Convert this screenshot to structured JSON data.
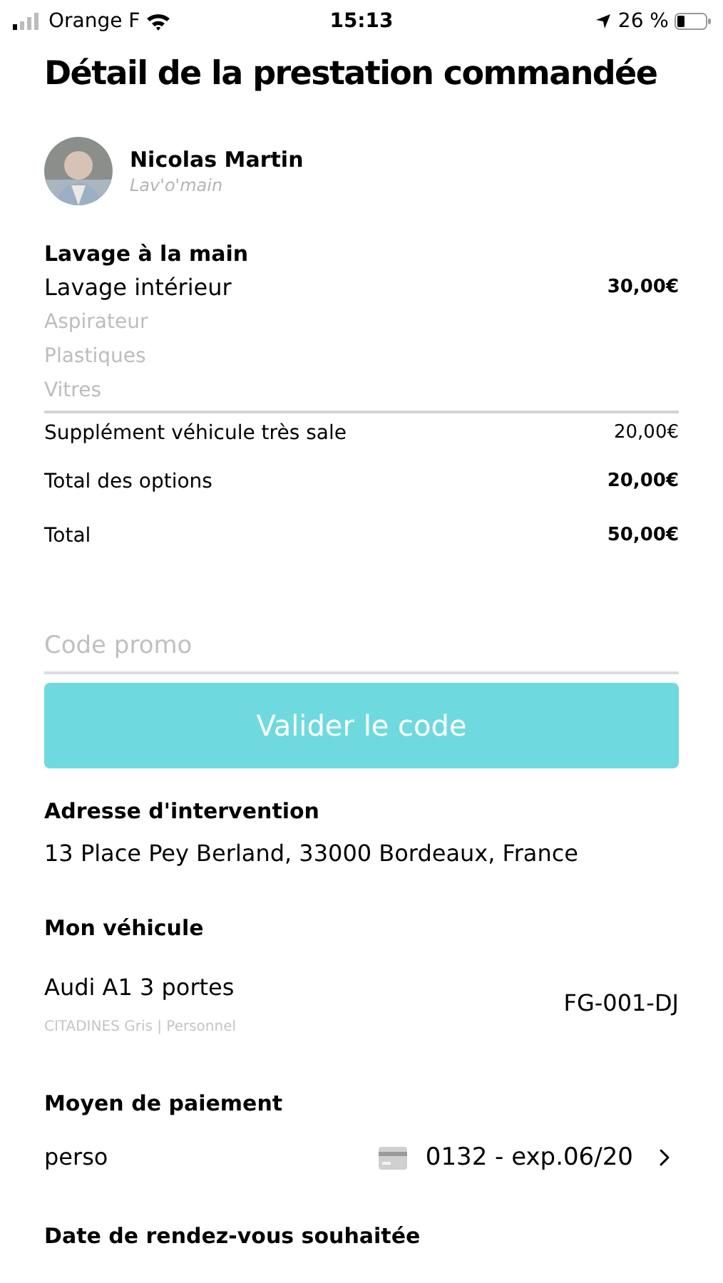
{
  "status_bar": {
    "carrier": "Orange F",
    "time": "15:13",
    "battery": "26 %"
  },
  "title": "Détail de la prestation commandée",
  "provider": {
    "name": "Nicolas Martin",
    "company": "Lav'o'main"
  },
  "service": {
    "heading": "Lavage à la main",
    "name": "Lavage intérieur",
    "price": "30,00€",
    "details": [
      "Aspirateur",
      "Plastiques",
      "Vitres"
    ]
  },
  "lines": [
    {
      "label": "Supplément véhicule très sale",
      "amount": "20,00€",
      "bold": false
    },
    {
      "label": "Total des options",
      "amount": "20,00€",
      "bold": true
    },
    {
      "label": "Total",
      "amount": "50,00€",
      "bold": true
    }
  ],
  "promo": {
    "placeholder": "Code promo",
    "button": "Valider le code"
  },
  "address": {
    "heading": "Adresse d'intervention",
    "value": "13 Place Pey Berland, 33000 Bordeaux, France"
  },
  "vehicle": {
    "heading": "Mon véhicule",
    "model": "Audi A1 3 portes",
    "details": "CITADINES Gris | Personnel",
    "plate": "FG-001-DJ"
  },
  "payment": {
    "heading": "Moyen de paiement",
    "name": "perso",
    "card": "0132 - exp.06/20"
  },
  "next_heading": "Date de rendez-vous souhaitée"
}
